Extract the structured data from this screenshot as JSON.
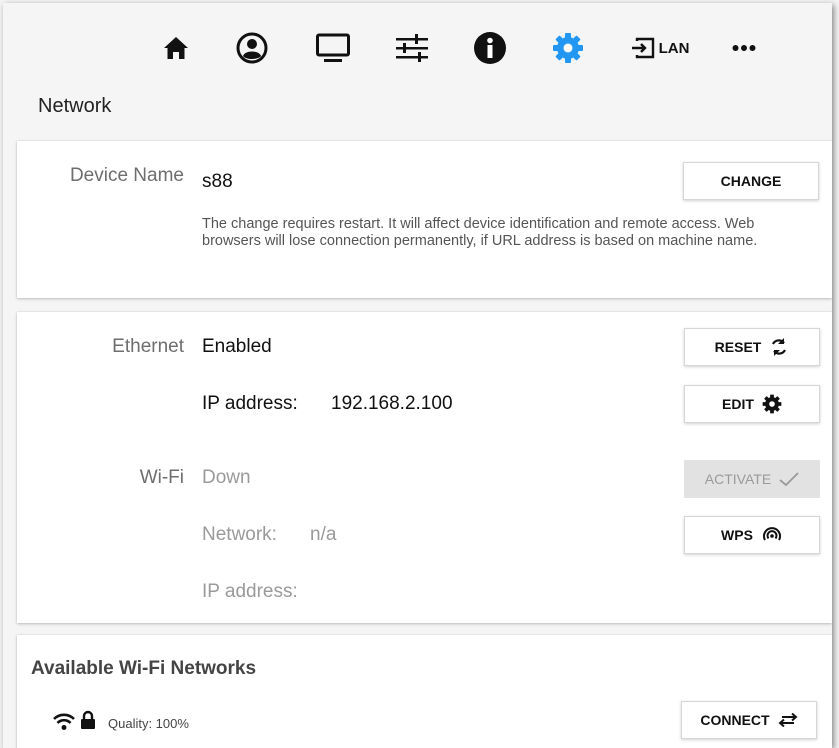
{
  "toolbar": {
    "items": [
      {
        "icon": "home-icon"
      },
      {
        "icon": "user-icon"
      },
      {
        "icon": "monitor-icon"
      },
      {
        "icon": "sliders-icon"
      },
      {
        "icon": "info-icon"
      },
      {
        "icon": "gear-icon",
        "active": true
      },
      {
        "icon": "input-icon",
        "label": "LAN"
      },
      {
        "icon": "more-icon"
      }
    ],
    "active_color": "#2196f3"
  },
  "page": {
    "title": "Network"
  },
  "device": {
    "label": "Device Name",
    "value": "s88",
    "button": "CHANGE",
    "note": "The change requires restart. It will affect device identification and remote access. Web browsers will lose connection permanently, if URL address is based on machine name."
  },
  "ethernet": {
    "label": "Ethernet",
    "status": "Enabled",
    "reset_button": "RESET",
    "ip_label": "IP address:",
    "ip_value": "192.168.2.100",
    "edit_button": "EDIT"
  },
  "wifi": {
    "label": "Wi-Fi",
    "status": "Down",
    "activate_button": "ACTIVATE",
    "network_label": "Network:",
    "network_value": "n/a",
    "wps_button": "WPS",
    "ip_label": "IP address:"
  },
  "networks": {
    "title": "Available Wi-Fi Networks",
    "items": [
      {
        "quality": "Quality: 100%",
        "secured": true,
        "button": "CONNECT"
      }
    ]
  }
}
